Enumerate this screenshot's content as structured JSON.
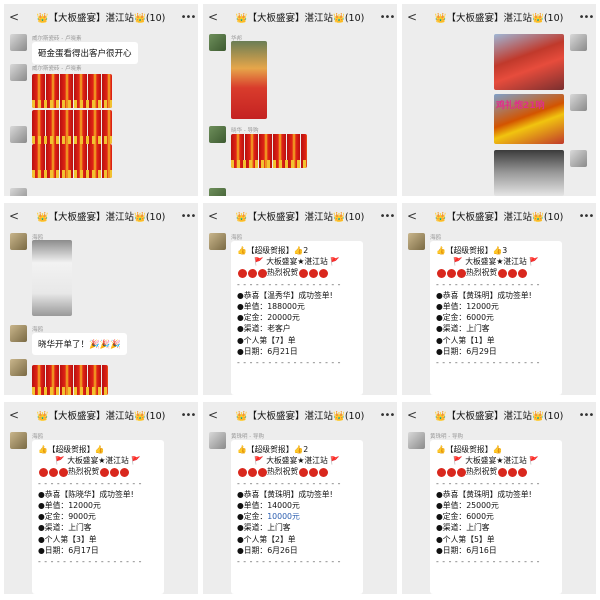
{
  "chat_title": "👑【大板盛宴】湛江站👑(10)",
  "panel1": {
    "sender1": "威尔斯瓷砖 - 卢晓素",
    "message": "砸金蛋看得出客户很开心",
    "sender2": "威尔斯瓷砖 - 卢晓素"
  },
  "panel2": {
    "sender1": "华邦",
    "sender2": "晓华 - 导购"
  },
  "panel3": {
    "caption": "鸡礼炮21响"
  },
  "panel4": {
    "sender1": "海鸥",
    "sender2": "海鸥",
    "message": "晓华开单了！🎉🎉🎉"
  },
  "panel5": {
    "sender": "海鸥",
    "header": "👍【超级贺报】👍2",
    "subtitle": "🚩 大板盛宴★湛江站 🚩",
    "festive": "热烈祝贺",
    "congrats": "●恭喜【温秀华】成功签单!",
    "price": "●单值：188000元",
    "deposit": "●定金：20000元",
    "channel": "●渠道：老客户",
    "personal": "●个人第【7】单",
    "date": "●日期：6月21日"
  },
  "panel6": {
    "sender": "海鸥",
    "header": "👍【超级贺报】👍3",
    "subtitle": "🚩 大板盛宴★湛江站 🚩",
    "festive": "热烈祝贺",
    "congrats": "●恭喜【黄珠明】成功签单!",
    "price": "●单值：12000元",
    "deposit": "●定金：6000元",
    "channel": "●渠道：上门客",
    "personal": "●个人第【1】单",
    "date": "●日期：6月29日"
  },
  "panel7": {
    "sender": "海鸥",
    "header": "👍【超级贺报】👍",
    "subtitle": "🚩 大板盛宴★湛江站 🚩",
    "festive": "热烈祝贺",
    "congrats": "●恭喜【陈晓华】成功签单!",
    "price": "●单值：12000元",
    "deposit": "●定金：9000元",
    "channel": "●渠道：上门客",
    "personal": "●个人第【3】单",
    "date": "●日期：6月17日"
  },
  "panel8": {
    "sender": "黄珠明 - 导购",
    "header": "👍【超级贺报】👍2",
    "subtitle": "🚩 大板盛宴★湛江站 🚩",
    "festive": "热烈祝贺",
    "congrats": "●恭喜【黄珠明】成功签单!",
    "price": "●单值：14000元",
    "deposit_label": "●定金：",
    "deposit_value": "10000元",
    "channel": "●渠道：上门客",
    "personal": "●个人第【2】单",
    "date": "●日期：6月26日"
  },
  "panel9": {
    "sender": "黄珠明 - 导购",
    "header": "👍【超级贺报】👍",
    "subtitle": "🚩 大板盛宴★湛江站 🚩",
    "festive": "热烈祝贺",
    "congrats": "●恭喜【黄珠明】成功签单!",
    "price": "●单值：25000元",
    "deposit": "●定金：6000元",
    "channel": "●渠道：上门客",
    "personal": "●个人第【5】单",
    "date": "●日期：6月16日"
  },
  "divider": "- - - - - - - - - - - - - - - - -",
  "icons": {
    "back": "chevron-left-icon",
    "more": "more-dots-icon"
  },
  "colors": {
    "chat_bg": "#ededed",
    "bubble": "#ffffff",
    "festive_red": "#d9281e",
    "link_blue": "#2a5db0"
  }
}
